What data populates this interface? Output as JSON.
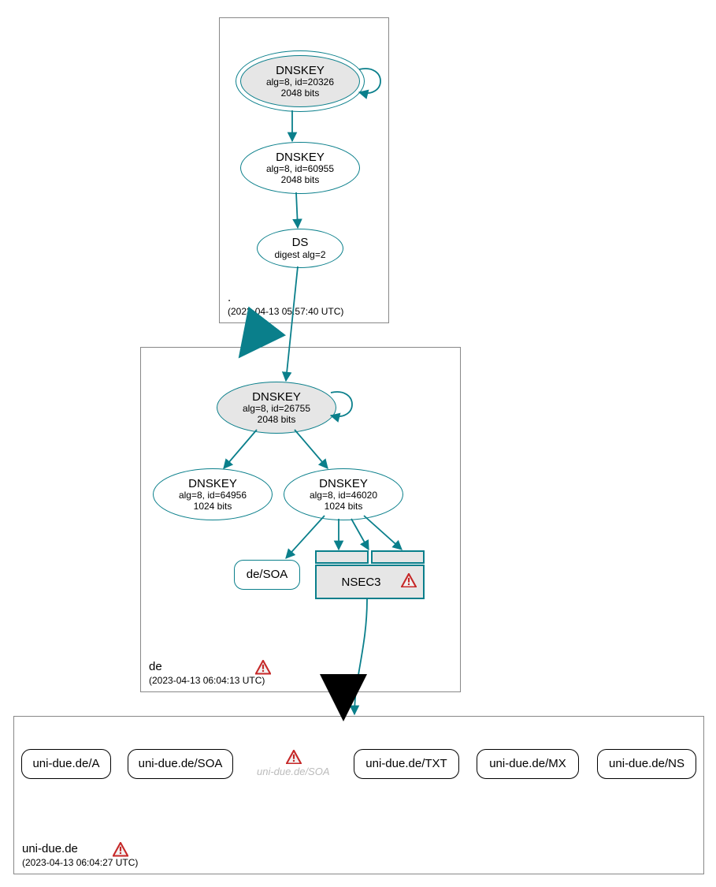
{
  "zones": {
    "root": {
      "name": ".",
      "timestamp": "(2023-04-13 05:57:40 UTC)"
    },
    "de": {
      "name": "de",
      "timestamp": "(2023-04-13 06:04:13 UTC)"
    },
    "uni_due": {
      "name": "uni-due.de",
      "timestamp": "(2023-04-13 06:04:27 UTC)"
    }
  },
  "nodes": {
    "root_ksk": {
      "title": "DNSKEY",
      "line2": "alg=8, id=20326",
      "line3": "2048 bits"
    },
    "root_zsk": {
      "title": "DNSKEY",
      "line2": "alg=8, id=60955",
      "line3": "2048 bits"
    },
    "root_ds": {
      "title": "DS",
      "line2": "digest alg=2"
    },
    "de_ksk": {
      "title": "DNSKEY",
      "line2": "alg=8, id=26755",
      "line3": "2048 bits"
    },
    "de_zsk_a": {
      "title": "DNSKEY",
      "line2": "alg=8, id=64956",
      "line3": "1024 bits"
    },
    "de_zsk_b": {
      "title": "DNSKEY",
      "line2": "alg=8, id=46020",
      "line3": "1024 bits"
    },
    "de_soa": {
      "label": "de/SOA"
    },
    "de_nsec3": {
      "label": "NSEC3"
    },
    "u_a": {
      "label": "uni-due.de/A"
    },
    "u_soa": {
      "label": "uni-due.de/SOA"
    },
    "u_soa_insecure": {
      "label": "uni-due.de/SOA"
    },
    "u_txt": {
      "label": "uni-due.de/TXT"
    },
    "u_mx": {
      "label": "uni-due.de/MX"
    },
    "u_ns": {
      "label": "uni-due.de/NS"
    }
  },
  "colors": {
    "teal": "#0a7f8b",
    "gray_fill": "#e6e6e6",
    "warn_red": "#c62828"
  }
}
